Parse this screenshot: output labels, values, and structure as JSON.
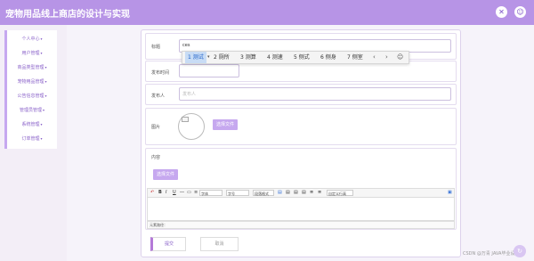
{
  "header": {
    "title": "宠物用品线上商店的设计与实现",
    "close_icon": "✕",
    "user_icon": "☺",
    "accent": "#b794e6"
  },
  "sidebar": {
    "items": [
      {
        "label": "个人中心"
      },
      {
        "label": "用户管理"
      },
      {
        "label": "商品类型管理"
      },
      {
        "label": "宠物用品管理"
      },
      {
        "label": "公告信息管理"
      },
      {
        "label": "管理员管理"
      },
      {
        "label": "系统管理"
      },
      {
        "label": "订单管理"
      }
    ],
    "caret": "▾"
  },
  "form": {
    "title_label": "标题",
    "title_value": "ces",
    "publish_time_label": "发布时间",
    "publisher_label": "发布人",
    "publisher_placeholder": "发布人",
    "image_label": "图片",
    "choose_file_label": "选择文件",
    "content_label": "内容",
    "content_choose_file_label": "选择文件",
    "submit_label": "提交",
    "cancel_label": "取消"
  },
  "ime": {
    "candidates": [
      "1 测试",
      "2 厕所",
      "3 测算",
      "4 测速",
      "5 侧式",
      "6 侧身",
      "7 侧室"
    ],
    "prev_icon": "‹",
    "next_icon": "›",
    "emoji_icon": "☺",
    "more_icon": "▾"
  },
  "editor": {
    "font_family_select": "字体",
    "font_size_select": "字号",
    "format_select": "段落格式",
    "line_height_select": "自定义行高",
    "status_text": "元素路径："
  },
  "watermark": "CSDN @万青 JAVA毕业设计",
  "float_button_icon": "↻"
}
